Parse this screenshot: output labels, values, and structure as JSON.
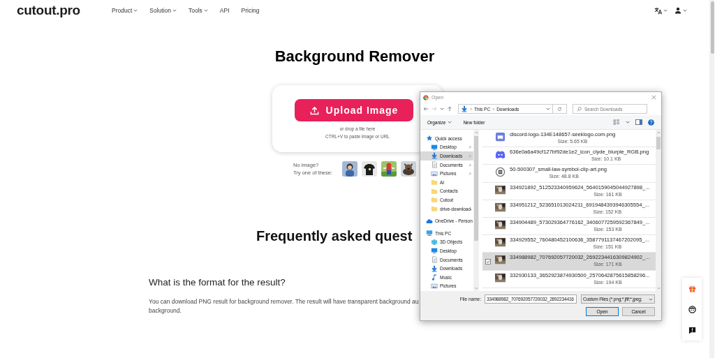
{
  "header": {
    "logo": "cutout.pro",
    "nav": [
      {
        "label": "Product",
        "dropdown": true
      },
      {
        "label": "Solution",
        "dropdown": true
      },
      {
        "label": "Tools",
        "dropdown": true
      },
      {
        "label": "API",
        "dropdown": false
      },
      {
        "label": "Pricing",
        "dropdown": false
      }
    ]
  },
  "hero": {
    "title": "Background Remover",
    "upload_button": "Upload Image",
    "hints": [
      "or drop a file here",
      "CTRL+V to paste image or URL"
    ],
    "samples_label": [
      "No image?",
      "Try one of these:"
    ],
    "samples": [
      {
        "kind": "picture"
      },
      {
        "kind": "picture"
      },
      {
        "kind": "picture"
      },
      {
        "kind": "picture"
      }
    ]
  },
  "faq": {
    "heading": "Frequently asked quest",
    "question": "What is the format for the result?",
    "answer_lines": [
      "You can download PNG result for background remover. The result will have transparent background au",
      "background."
    ]
  },
  "dialog": {
    "title": "Open",
    "path": [
      "This PC",
      "Downloads"
    ],
    "search_placeholder": "Search Downloads",
    "toolbar": [
      {
        "label": "Organize",
        "dropdown": true
      },
      {
        "label": "New folder",
        "dropdown": false
      }
    ],
    "nav": [
      {
        "label": "Quick access",
        "kind": "star",
        "pinned": false,
        "selected": false,
        "children": [
          {
            "label": "Desktop",
            "kind": "desktop",
            "pinned": true,
            "selected": false
          },
          {
            "label": "Downloads",
            "kind": "download",
            "pinned": true,
            "selected": true
          },
          {
            "label": "Documents",
            "kind": "document",
            "pinned": true,
            "selected": false
          },
          {
            "label": "Pictures",
            "kind": "picture-file",
            "pinned": true,
            "selected": false
          },
          {
            "label": "AI",
            "kind": "folder",
            "pinned": false,
            "selected": false
          },
          {
            "label": "Contacts",
            "kind": "folder",
            "pinned": false,
            "selected": false
          },
          {
            "label": "Cutout",
            "kind": "folder",
            "pinned": false,
            "selected": false
          },
          {
            "label": "drive-download-",
            "kind": "folder",
            "pinned": false,
            "selected": false
          }
        ]
      },
      {
        "label": "OneDrive - Person",
        "kind": "cloud",
        "pinned": false,
        "selected": false
      },
      {
        "label": "This PC",
        "kind": "pc",
        "pinned": false,
        "selected": false,
        "children": [
          {
            "label": "3D Objects",
            "kind": "cube",
            "pinned": false,
            "selected": false
          },
          {
            "label": "Desktop",
            "kind": "desktop",
            "pinned": false,
            "selected": false
          },
          {
            "label": "Documents",
            "kind": "document",
            "pinned": false,
            "selected": false
          },
          {
            "label": "Downloads",
            "kind": "download",
            "pinned": false,
            "selected": false
          },
          {
            "label": "Music",
            "kind": "music",
            "pinned": false,
            "selected": false
          },
          {
            "label": "Pictures",
            "kind": "picture-file",
            "pinned": false,
            "selected": false
          }
        ]
      }
    ],
    "files": [
      {
        "name": "discord-logo-134E148657-seeklogo.com.png",
        "size": "Size: 5.65 KB",
        "kind": "chat-square",
        "selected": false
      },
      {
        "name": "636e0a6a49cf127bf92de1e2_icon_clyde_blurple_RGB.png",
        "size": "Size: 10.1 KB",
        "kind": "chat",
        "selected": false
      },
      {
        "name": "50-500307_small-law-symbol-clip-art.png",
        "size": "Size: 48.8 KB",
        "kind": "emblem",
        "selected": false
      },
      {
        "name": "334921892_512523340959624_5640159045044927898_...",
        "size": "Size: 161 KB",
        "selected": false
      },
      {
        "name": "334951212_523651013024211_6919484393946305554_...",
        "size": "Size: 152 KB",
        "selected": false
      },
      {
        "name": "334904489_573029364776162_3406077259592367849_...",
        "size": "Size: 153 KB",
        "selected": false
      },
      {
        "name": "334929552_760480452100636_3587791137467202095_...",
        "size": "Size: 151 KB",
        "selected": false
      },
      {
        "name": "334988982_707692057720032_2692234416309824902_...",
        "size": "Size: 171 KB",
        "selected": true
      },
      {
        "name": "332930133_3652923874930500_25706428756158582​96...",
        "size": "Size: 194 KB",
        "selected": false
      }
    ],
    "file_name_label": "File name:",
    "file_name": "334988982_707692057720032_2692234416",
    "file_type": "Custom Files (*.png;*.jfif;*.jpeg;",
    "buttons": [
      "Open",
      "Cancel"
    ]
  }
}
